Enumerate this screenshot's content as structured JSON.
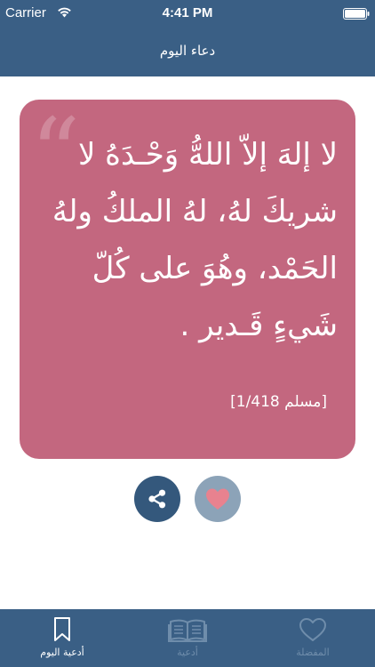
{
  "status_bar": {
    "carrier": "Carrier",
    "time": "4:41 PM",
    "wifi_icon": "wifi-icon",
    "battery_icon": "battery-icon"
  },
  "header": {
    "title": "دعاء اليوم"
  },
  "card": {
    "quote_icon": "quote-icon",
    "text": "لا إلهَ إلاّ اللهُّ وَحْـدَهُ لا شريكَ لهُ، لهُ الملكُ ولهُ الحَمْد، وهُوَ على كُلّ شَيءٍ قَـدير .",
    "source": "[مسلم 1/418]",
    "background_color": "#c3677f"
  },
  "actions": {
    "share_icon": "share-icon",
    "favorite_icon": "heart-icon"
  },
  "tabbar": {
    "tabs": [
      {
        "label": "أدعية اليوم",
        "icon": "bookmark-icon",
        "active": true
      },
      {
        "label": "أدعية",
        "icon": "open-book-icon",
        "active": false
      },
      {
        "label": "المفضلة",
        "icon": "heart-outline-icon",
        "active": false
      }
    ]
  },
  "colors": {
    "nav_background": "#3a5f85",
    "share_button": "#34587c",
    "favorite_button": "#8ca3b8",
    "heart": "#e8828f",
    "inactive_tab": "#6f8dab"
  }
}
